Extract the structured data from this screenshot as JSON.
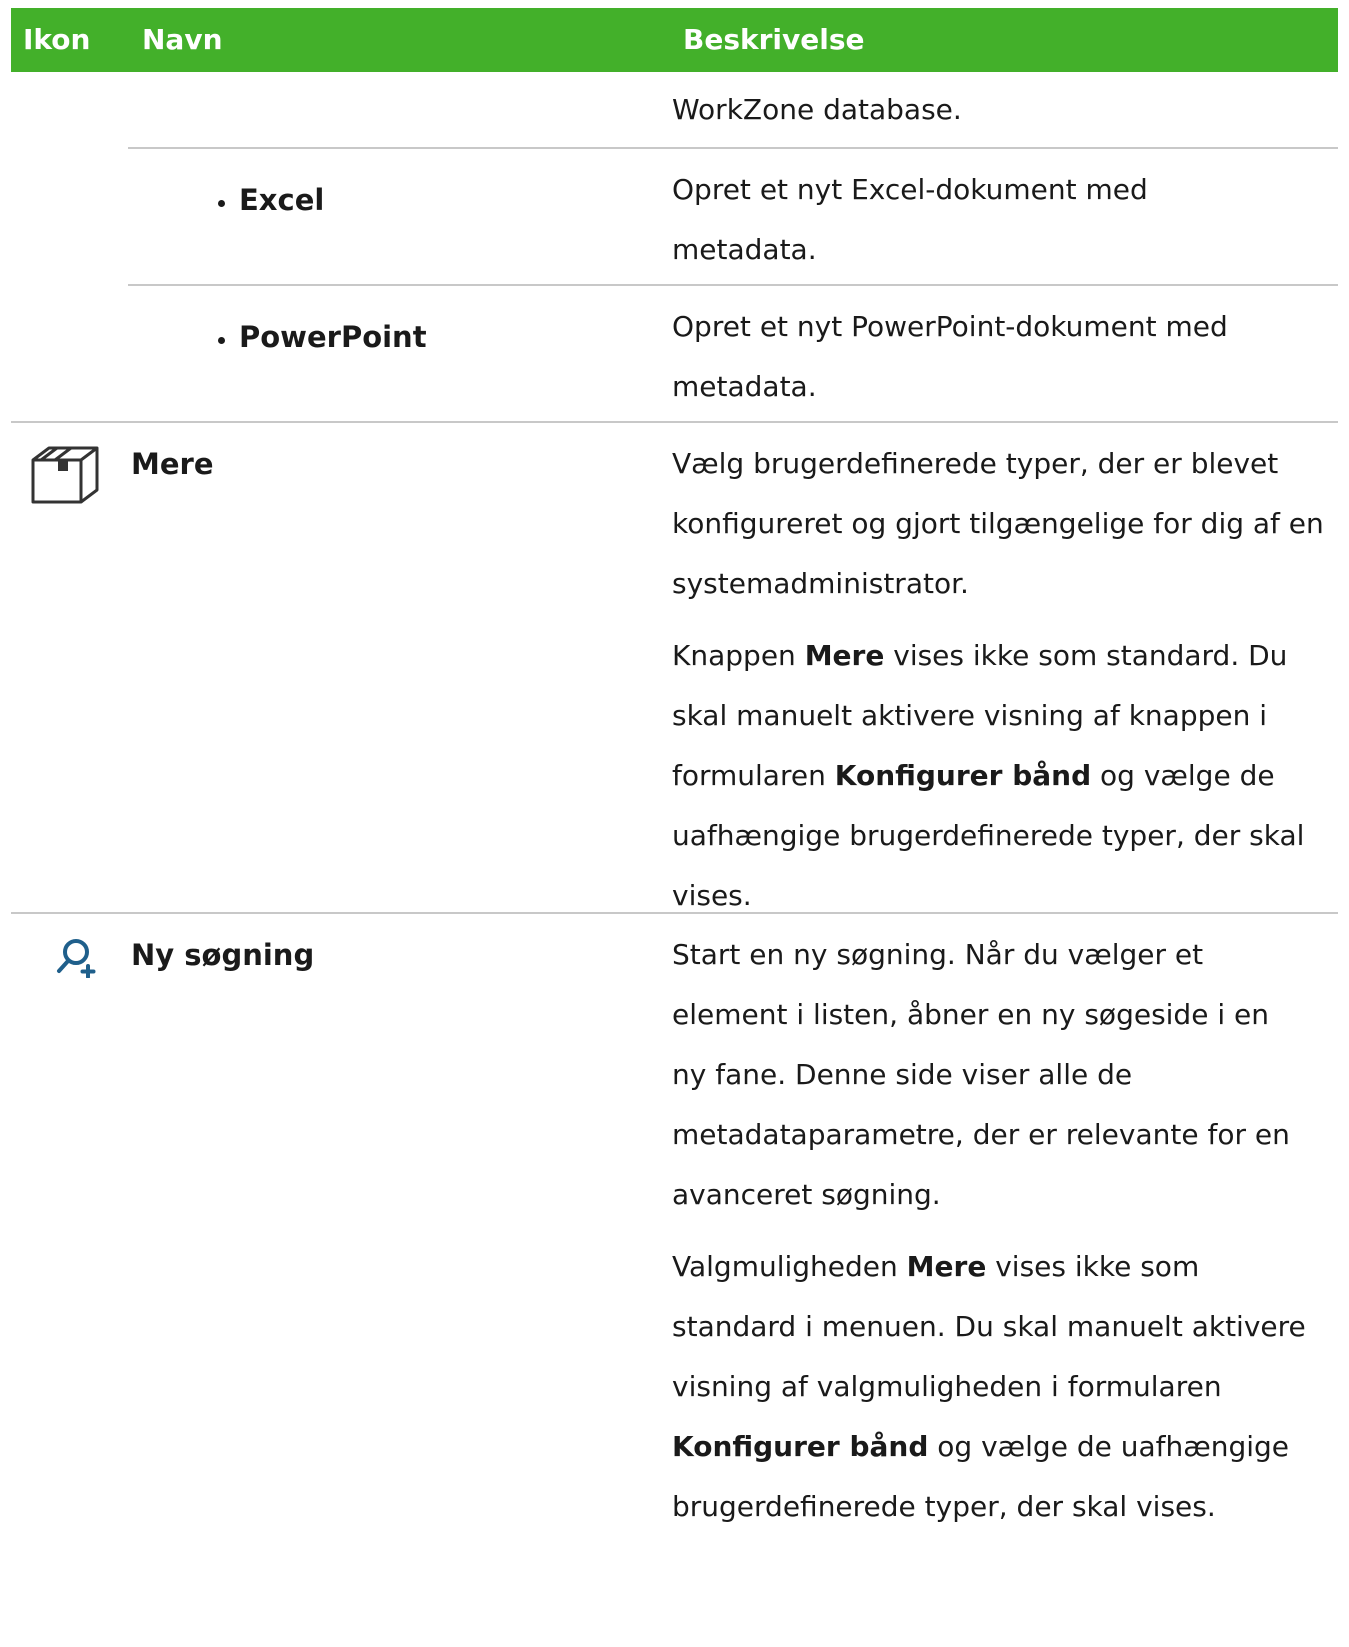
{
  "header": {
    "col_icon": "Ikon",
    "col_name": "Navn",
    "col_desc": "Beskrivelse"
  },
  "rows": {
    "workzone": {
      "desc": "WorkZone database."
    },
    "excel": {
      "name": "Excel",
      "desc": "Opret et nyt Excel-dokument med metadata."
    },
    "powerpoint": {
      "name": "PowerPoint",
      "desc": "Opret et nyt PowerPoint-dokument med metadata."
    },
    "mere": {
      "icon": "package-box-icon",
      "name": "Mere",
      "desc1": "Vælg brugerdefinerede typer, der er blevet konfigureret og gjort tilgængelige for dig af en systemadministrator.",
      "desc2_pre": "Knappen ",
      "desc2_bold": "Mere",
      "desc2_mid": " vises ikke som standard. Du skal manuelt aktivere visning af knappen i formularen ",
      "desc2_bold2": "Konfigurer bånd",
      "desc2_post": " og vælge de uafhængige brugerdefinerede typer, der skal vises."
    },
    "search": {
      "icon": "new-search-icon",
      "name": "Ny søgning",
      "desc1": "Start en ny søgning. Når du vælger et element i listen, åbner en ny søgeside i en ny fane. Denne side viser alle de metadataparametre, der er relevante for en avanceret søgning.",
      "desc2_pre": "Valgmuligheden ",
      "desc2_bold": "Mere",
      "desc2_mid": " vises ikke som standard i menuen. Du skal manuelt aktivere visning af valgmuligheden i formularen ",
      "desc2_bold2": "Konfigurer bånd",
      "desc2_post": " og vælge de uafhængige brugerdefinerede typer, der skal vises."
    }
  },
  "colors": {
    "header_bg": "#43b02a",
    "header_text": "#ffffff",
    "divider": "#c8c8c8",
    "icon_blue": "#1f5f8b"
  }
}
